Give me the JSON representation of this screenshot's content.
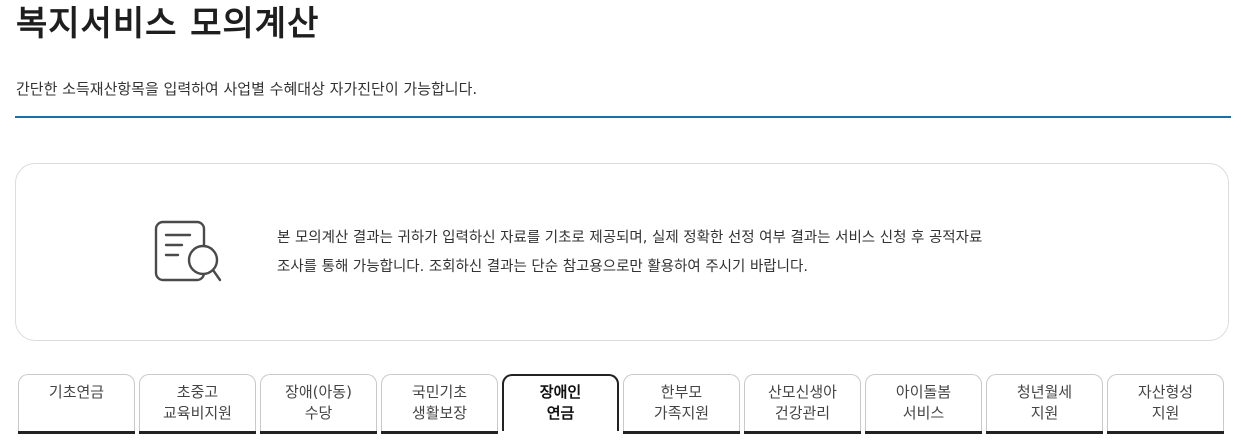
{
  "header": {
    "title": "복지서비스 모의계산",
    "subtitle": "간단한 소득재산항목을 입력하여 사업별 수혜대상 자가진단이 가능합니다."
  },
  "notice": {
    "icon": "document-search-icon",
    "line1": "본 모의계산 결과는 귀하가 입력하신 자료를 기초로 제공되며, 실제 정확한 선정 여부 결과는 서비스 신청 후 공적자료",
    "line2": "조사를 통해 가능합니다. 조회하신 결과는 단순 참고용으로만 활용하여 주시기 바랍니다."
  },
  "tabs": [
    {
      "line1": "기초연금",
      "line2": ""
    },
    {
      "line1": "초중고",
      "line2": "교육비지원"
    },
    {
      "line1": "장애(아동)",
      "line2": "수당"
    },
    {
      "line1": "국민기초",
      "line2": "생활보장"
    },
    {
      "line1": "장애인",
      "line2": "연금"
    },
    {
      "line1": "한부모",
      "line2": "가족지원"
    },
    {
      "line1": "산모신생아",
      "line2": "건강관리"
    },
    {
      "line1": "아이돌봄",
      "line2": "서비스"
    },
    {
      "line1": "청년월세",
      "line2": "지원"
    },
    {
      "line1": "자산형성",
      "line2": "지원"
    }
  ],
  "active_tab": "장애인 연금",
  "colors": {
    "accent_line": "#1a6fa8",
    "active_border": "#222222",
    "box_border": "#dcdcdc"
  }
}
